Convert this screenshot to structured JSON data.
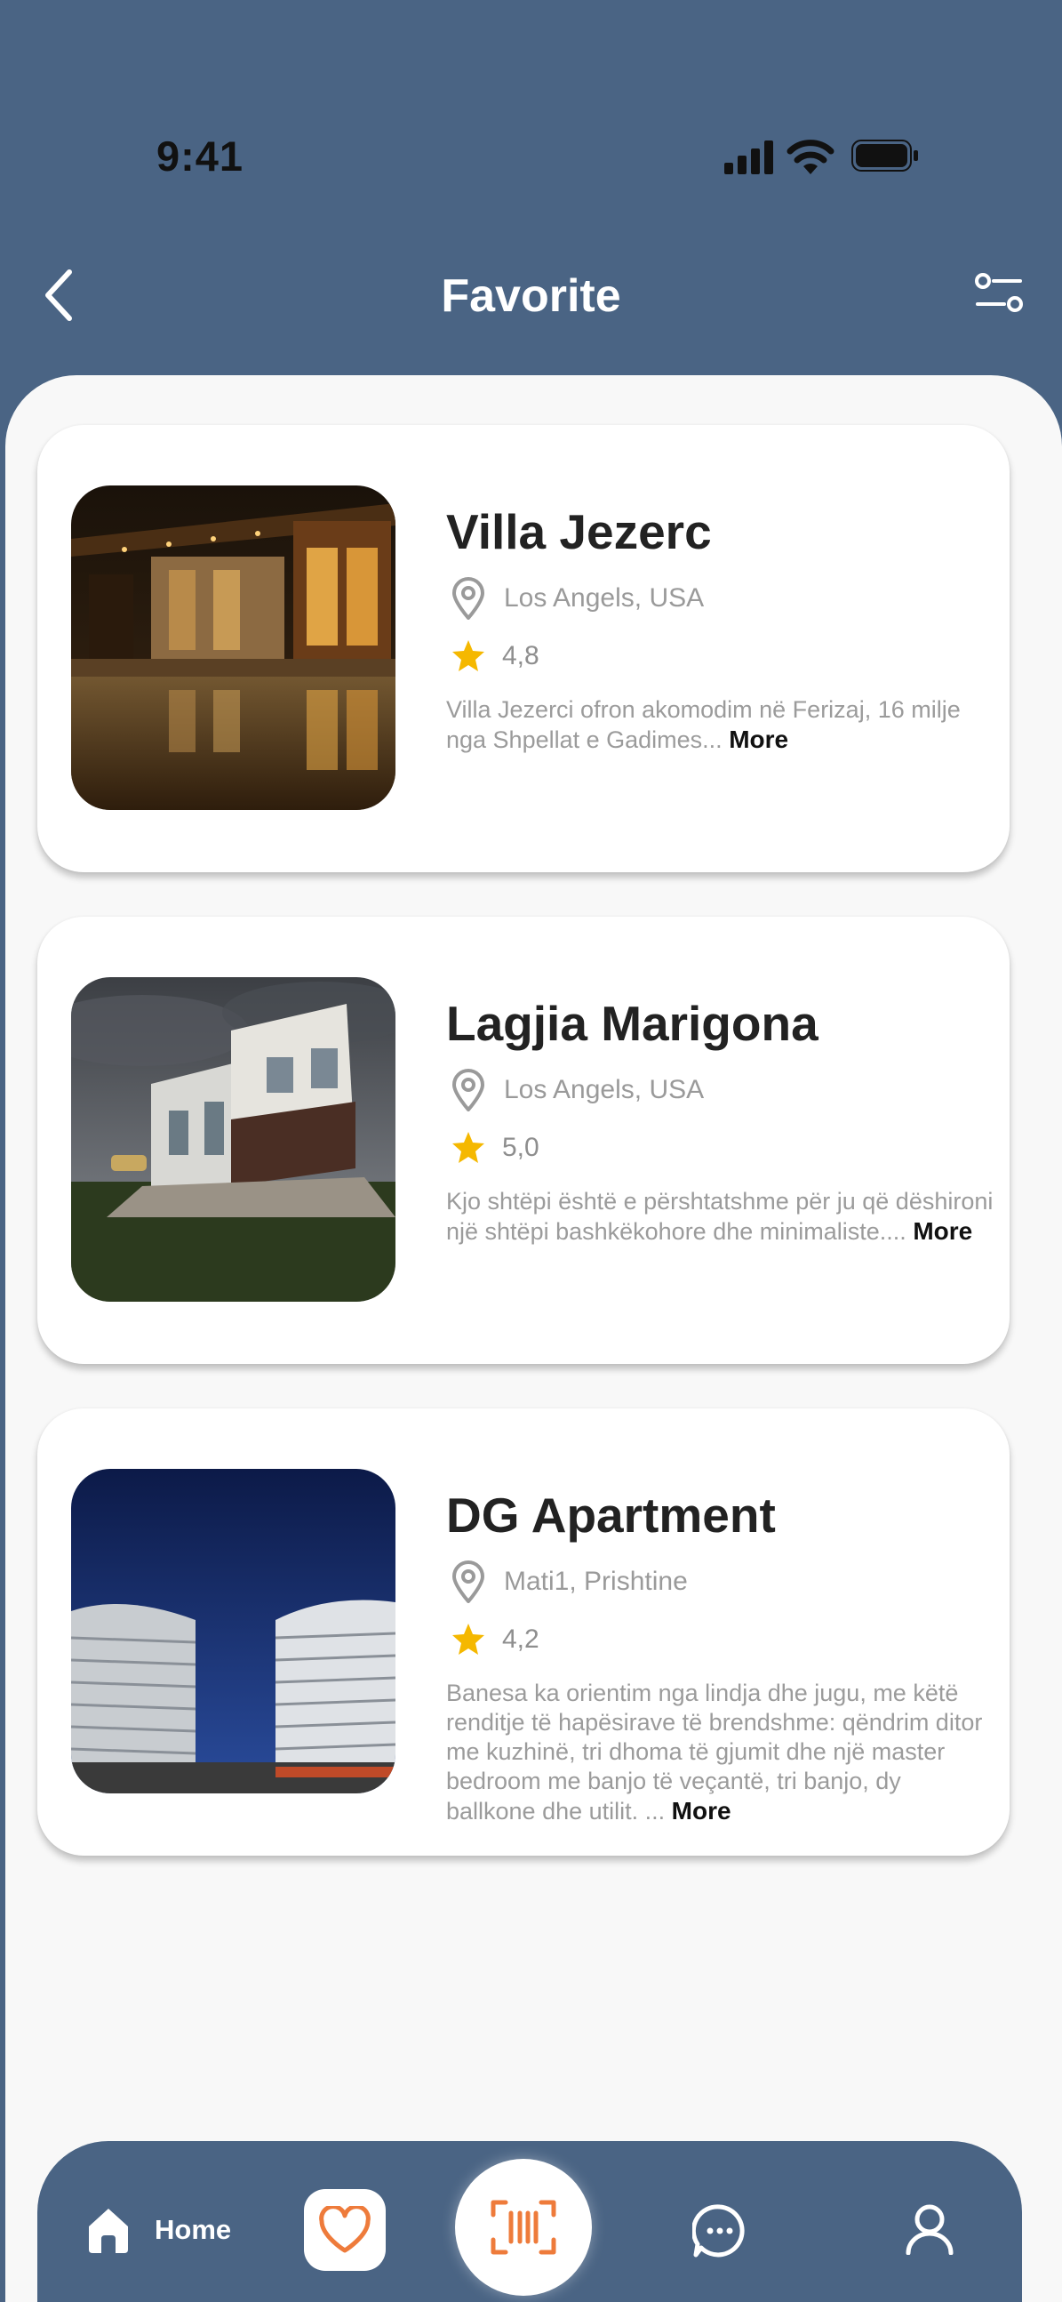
{
  "status_bar": {
    "time": "9:41"
  },
  "header": {
    "title": "Favorite"
  },
  "properties": [
    {
      "name": "Villa Jezerc",
      "location": "Los Angels, USA",
      "rating": "4,8",
      "description": "Villa Jezerci  ofron akomodim në Ferizaj, 16 milje nga Shpellat e Gadimes...",
      "more_label": "More"
    },
    {
      "name": "Lagjia Marigona",
      "location": "Los Angels, USA",
      "rating": "5,0",
      "description_line1": "Kjo shtëpi është e përshtatshme për ju që dëshironi",
      "description_line2": "një shtëpi bashkëkohore dhe minimaliste....",
      "more_label": "More"
    },
    {
      "name": "DG Apartment",
      "location": "Mati1, Prishtine",
      "rating": "4,2",
      "description": "Banesa ka orientim nga lindja dhe jugu, me këtë renditje të hapësirave të brendshme: qëndrim ditor me kuzhinë, tri dhoma të gjumit dhe një master bedroom me banjo të veçantë, tri banjo, dy ballkone dhe utilit. ...",
      "more_label": "More"
    }
  ],
  "bottom_nav": {
    "home_label": "Home",
    "icons": [
      "home-icon",
      "heart-icon",
      "barcode-scan-icon",
      "chat-icon",
      "profile-icon"
    ]
  },
  "colors": {
    "primary": "#4a6484",
    "accent": "#ee7b3b",
    "star": "#f5b800",
    "background": "#f8f8f8"
  }
}
